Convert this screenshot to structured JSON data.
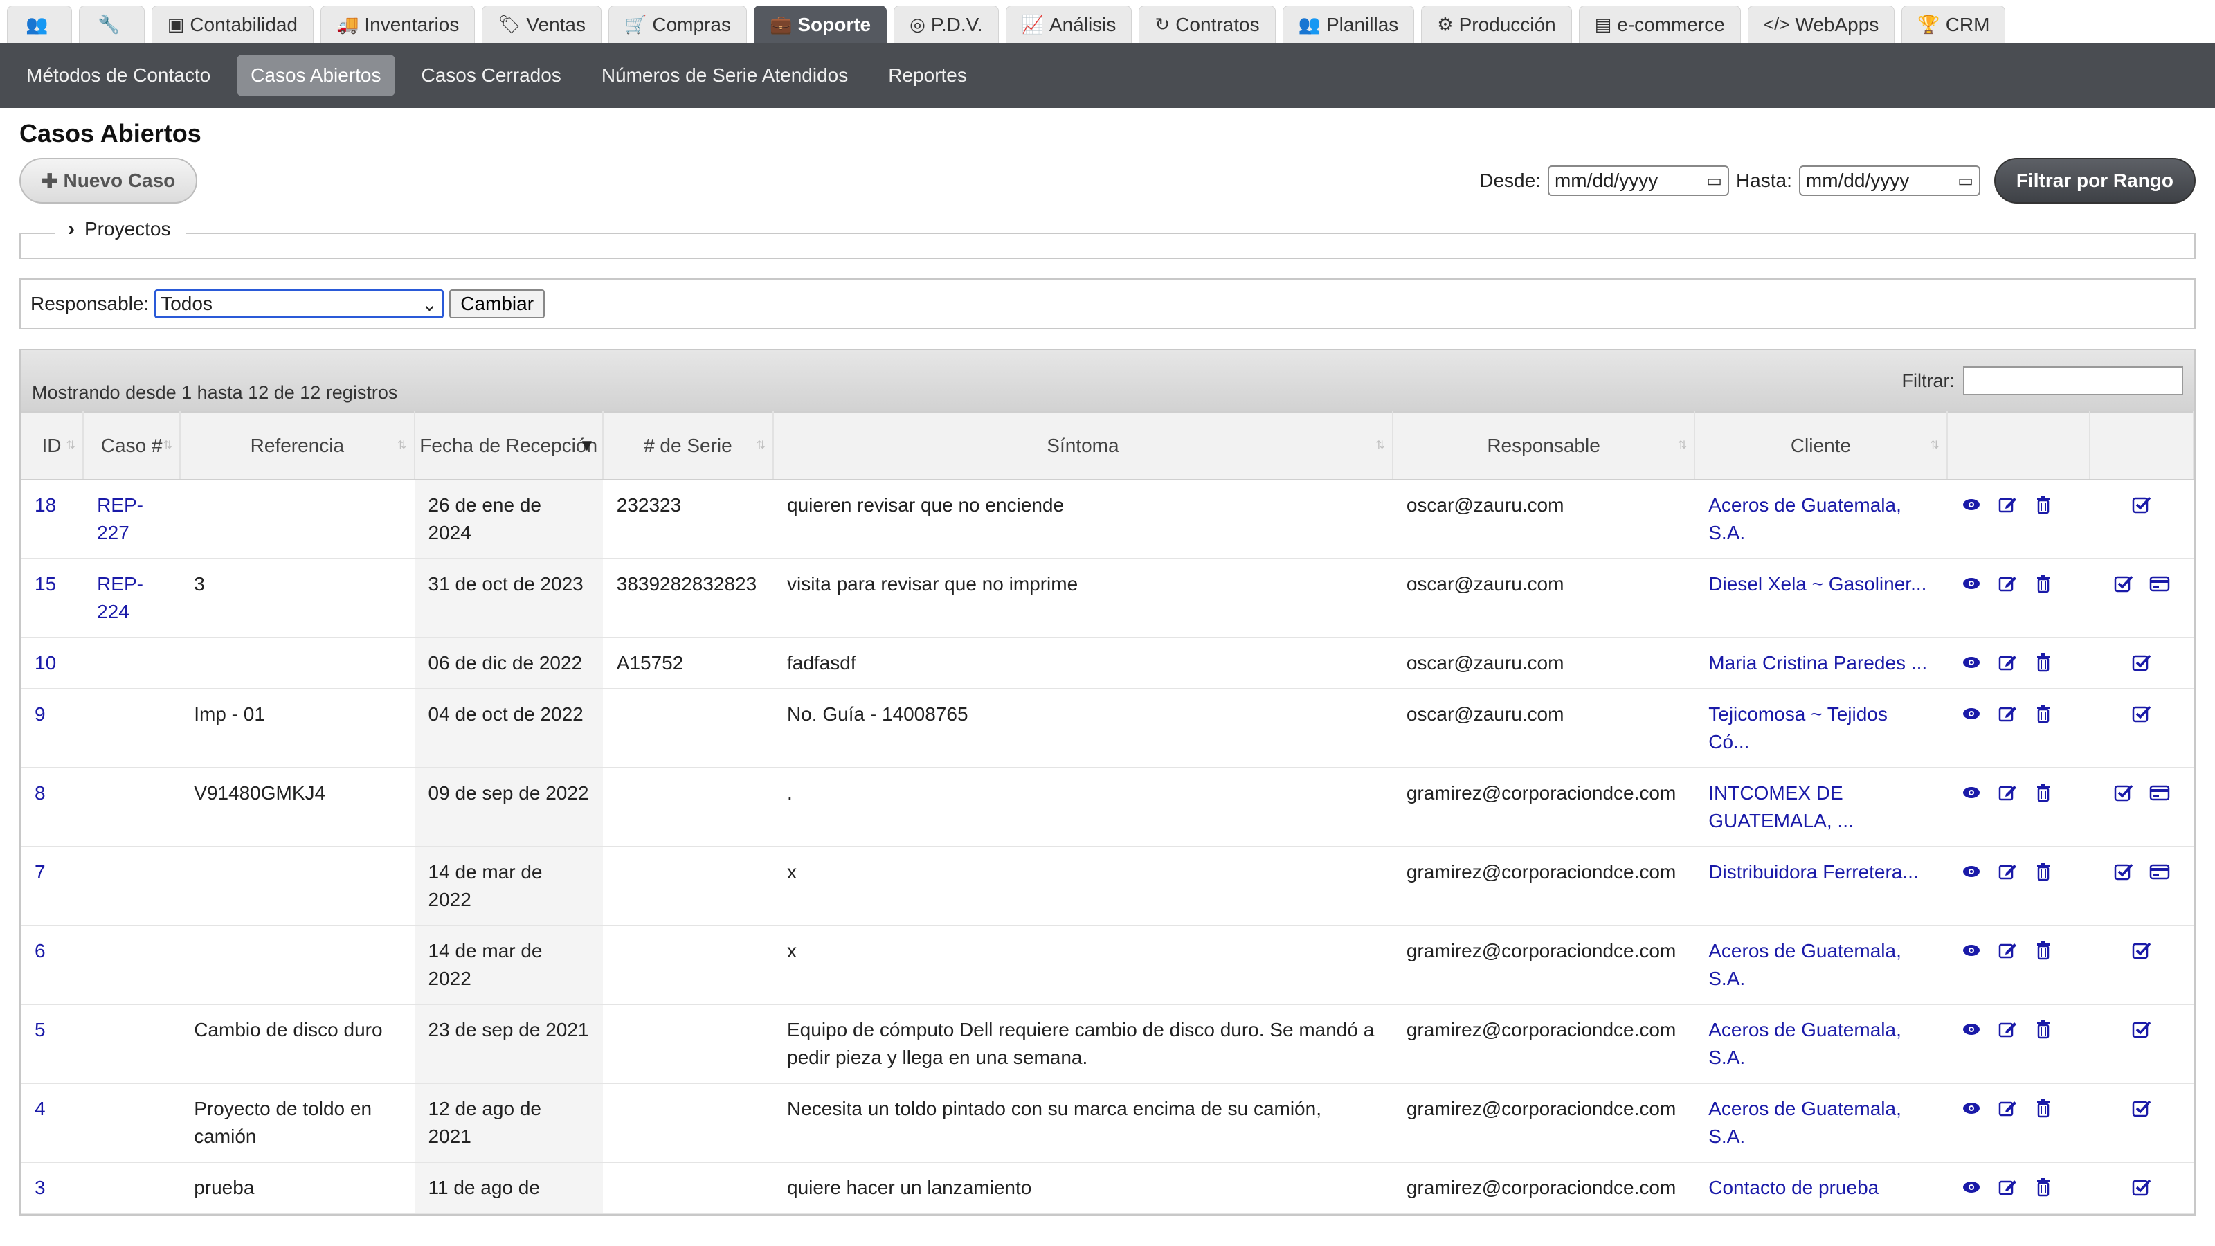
{
  "top_tabs": [
    {
      "label": "",
      "icon": "users-icon",
      "active": false
    },
    {
      "label": "",
      "icon": "wrench-icon",
      "active": false
    },
    {
      "label": "Contabilidad",
      "icon": "money-icon",
      "active": false
    },
    {
      "label": "Inventarios",
      "icon": "truck-icon",
      "active": false
    },
    {
      "label": "Ventas",
      "icon": "tags-icon",
      "active": false
    },
    {
      "label": "Compras",
      "icon": "cart-icon",
      "active": false
    },
    {
      "label": "Soporte",
      "icon": "briefcase-icon",
      "active": true
    },
    {
      "label": "P.D.V.",
      "icon": "target-icon",
      "active": false
    },
    {
      "label": "Análisis",
      "icon": "chart-icon",
      "active": false
    },
    {
      "label": "Contratos",
      "icon": "refresh-icon",
      "active": false
    },
    {
      "label": "Planillas",
      "icon": "group-icon",
      "active": false
    },
    {
      "label": "Producción",
      "icon": "cogs-icon",
      "active": false
    },
    {
      "label": "e-commerce",
      "icon": "card-icon",
      "active": false
    },
    {
      "label": "WebApps",
      "icon": "code-icon",
      "active": false
    },
    {
      "label": "CRM",
      "icon": "trophy-icon",
      "active": false
    }
  ],
  "sub_nav": [
    {
      "label": "Métodos de Contacto",
      "active": false
    },
    {
      "label": "Casos Abiertos",
      "active": true
    },
    {
      "label": "Casos Cerrados",
      "active": false
    },
    {
      "label": "Números de Serie Atendidos",
      "active": false
    },
    {
      "label": "Reportes",
      "active": false
    }
  ],
  "page": {
    "title": "Casos Abiertos",
    "new_case_label": "Nuevo Caso",
    "from_label": "Desde:",
    "to_label": "Hasta:",
    "from_placeholder": "mm/dd/yyyy",
    "to_placeholder": "mm/dd/yyyy",
    "filter_range_label": "Filtrar por Rango",
    "projects_legend": "Proyectos",
    "responsible_label": "Responsable:",
    "responsible_value": "Todos",
    "change_label": "Cambiar"
  },
  "table": {
    "info": "Mostrando desde 1 hasta 12 de 12 registros",
    "filter_label": "Filtrar:",
    "columns": [
      "ID",
      "Caso #",
      "Referencia",
      "Fecha de Recepción",
      "# de Serie",
      "Síntoma",
      "Responsable",
      "Cliente"
    ],
    "rows": [
      {
        "id": "18",
        "caso": "REP-227",
        "referencia": "",
        "fecha": "26 de ene de 2024",
        "serie": "232323",
        "sintoma": "quieren revisar que no enciende",
        "responsable": "oscar@zauru.com",
        "cliente": "Aceros de Guatemala, S.A.",
        "extra": false
      },
      {
        "id": "15",
        "caso": "REP-224",
        "referencia": "3",
        "fecha": "31 de oct de 2023",
        "serie": "3839282832823",
        "sintoma": "visita para revisar que no imprime",
        "responsable": "oscar@zauru.com",
        "cliente": "Diesel Xela ~ Gasoliner...",
        "extra": true
      },
      {
        "id": "10",
        "caso": "",
        "referencia": "",
        "fecha": "06 de dic de 2022",
        "serie": "A15752",
        "sintoma": "fadfasdf",
        "responsable": "oscar@zauru.com",
        "cliente": "Maria Cristina Paredes ...",
        "extra": false
      },
      {
        "id": "9",
        "caso": "",
        "referencia": "Imp - 01",
        "fecha": "04 de oct de 2022",
        "serie": "",
        "sintoma": "No. Guía - 14008765",
        "responsable": "oscar@zauru.com",
        "cliente": "Tejicomosa ~ Tejidos Có...",
        "extra": false
      },
      {
        "id": "8",
        "caso": "",
        "referencia": "V91480GMKJ4",
        "fecha": "09 de sep de 2022",
        "serie": "",
        "sintoma": ".",
        "responsable": "gramirez@corporaciondce.com",
        "cliente": "INTCOMEX DE GUATEMALA, ...",
        "extra": true
      },
      {
        "id": "7",
        "caso": "",
        "referencia": "",
        "fecha": "14 de mar de 2022",
        "serie": "",
        "sintoma": "x",
        "responsable": "gramirez@corporaciondce.com",
        "cliente": "Distribuidora Ferretera...",
        "extra": true
      },
      {
        "id": "6",
        "caso": "",
        "referencia": "",
        "fecha": "14 de mar de 2022",
        "serie": "",
        "sintoma": "x",
        "responsable": "gramirez@corporaciondce.com",
        "cliente": "Aceros de Guatemala, S.A.",
        "extra": false
      },
      {
        "id": "5",
        "caso": "",
        "referencia": "Cambio de disco duro",
        "fecha": "23 de sep de 2021",
        "serie": "",
        "sintoma": "Equipo de cómputo Dell requiere cambio de disco duro. Se mandó a pedir pieza y llega en una semana.",
        "responsable": "gramirez@corporaciondce.com",
        "cliente": "Aceros de Guatemala, S.A.",
        "extra": false
      },
      {
        "id": "4",
        "caso": "",
        "referencia": "Proyecto de toldo en camión",
        "fecha": "12 de ago de 2021",
        "serie": "",
        "sintoma": "Necesita un toldo pintado con su marca encima de su camión,",
        "responsable": "gramirez@corporaciondce.com",
        "cliente": "Aceros de Guatemala, S.A.",
        "extra": false
      },
      {
        "id": "3",
        "caso": "",
        "referencia": "prueba",
        "fecha": "11 de ago de",
        "serie": "",
        "sintoma": "quiere hacer un lanzamiento",
        "responsable": "gramirez@corporaciondce.com",
        "cliente": "Contacto de prueba",
        "extra": false
      }
    ]
  },
  "colors": {
    "link": "#1a1aa8",
    "active_tab": "#555960",
    "subnav": "#4a4d52"
  }
}
